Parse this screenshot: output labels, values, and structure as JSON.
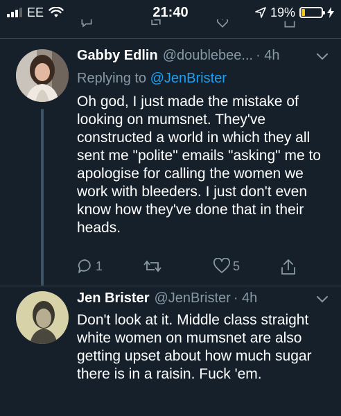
{
  "status_bar": {
    "carrier": "EE",
    "time": "21:40",
    "battery": "19%",
    "battery_level": 0.19
  },
  "tweets": [
    {
      "name": "Gabby Edlin",
      "handle": "@doublebee...",
      "time": "· 4h",
      "replying_prefix": "Replying to",
      "replying_to": "@JenBrister",
      "text": "Oh god, I just made the mistake of looking on mumsnet. They've constructed a world in which they all sent me \"polite\" emails \"asking\" me to apologise for calling the women we work with bleeders. I just don't even know how they've done that in their heads.",
      "reply_count": "1",
      "like_count": "5"
    },
    {
      "name": "Jen Brister",
      "handle": "@JenBrister",
      "time": "· 4h",
      "text": "Don't look at it. Middle class straight white women on mumsnet are also getting upset about how much sugar there is in a raisin. Fuck 'em."
    }
  ],
  "colors": {
    "background": "#15202b",
    "secondary_text": "#8899a6",
    "link": "#1da1f2",
    "battery": "#f5c518"
  }
}
